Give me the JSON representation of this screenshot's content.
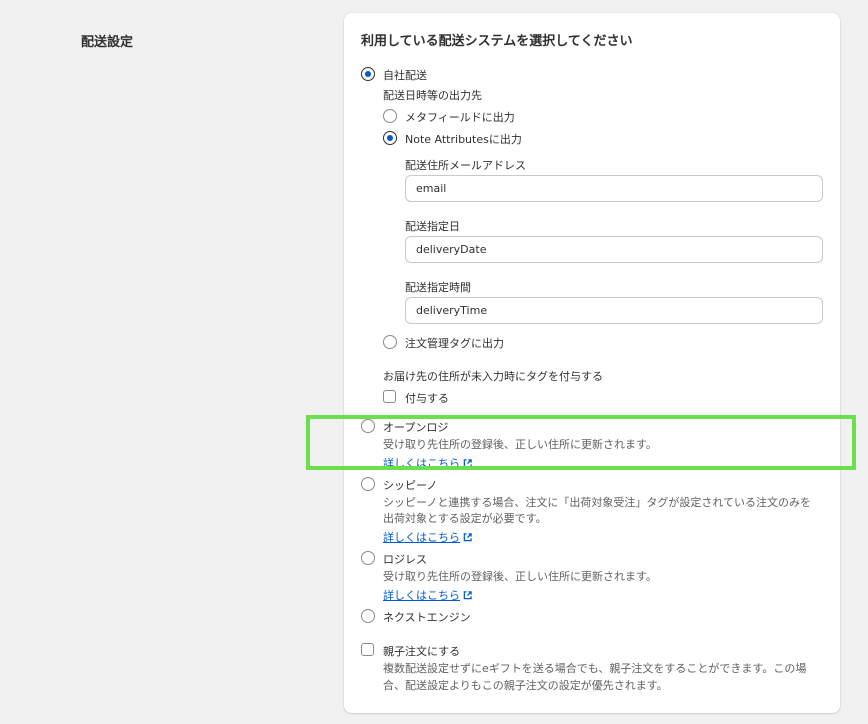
{
  "section": {
    "title": "配送設定"
  },
  "card": {
    "title": "利用している配送システムを選択してください",
    "own_delivery": {
      "label": "自社配送",
      "output_label": "配送日時等の出力先",
      "metafield_label": "メタフィールドに出力",
      "note_attr_label": "Note Attributesに出力",
      "email_label": "配送住所メールアドレス",
      "email_value": "email",
      "date_label": "配送指定日",
      "date_value": "deliveryDate",
      "time_label": "配送指定時間",
      "time_value": "deliveryTime",
      "order_tag_label": "注文管理タグに出力",
      "missing_address_label": "お届け先の住所が未入力時にタグを付与する",
      "add_tag_label": "付与する"
    },
    "open_logi": {
      "label": "オープンロジ",
      "desc": "受け取り先住所の登録後、正しい住所に更新されます。",
      "link": "詳しくはこちら"
    },
    "shippino": {
      "label": "シッピーノ",
      "desc_line1": "シッピーノと連携する場合、注文に「出荷対象受注」タグが設定されている注文のみを",
      "desc_line2": "出荷対象とする設定が必要です。",
      "link": "詳しくはこちら"
    },
    "logiless": {
      "label": "ロジレス",
      "desc": "受け取り先住所の登録後、正しい住所に更新されます。",
      "link": "詳しくはこちら"
    },
    "next_engine": {
      "label": "ネクストエンジン"
    },
    "parent_order": {
      "label": "親子注文にする",
      "desc_line1": "複数配送設定せずにeギフトを送る場合でも、親子注文をすることができます。この場",
      "desc_line2": "合、配送設定よりもこの親子注文の設定が優先されます。"
    }
  },
  "colors": {
    "accent": "#005bd3",
    "highlight": "#6cdf4f",
    "background": "#f1f1f1"
  }
}
